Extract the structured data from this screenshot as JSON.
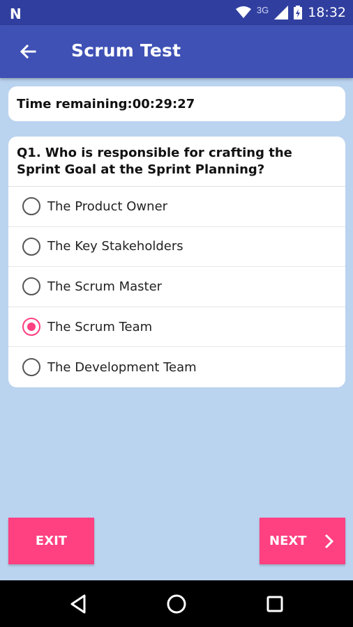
{
  "status_bar": {
    "notification_icon": "N",
    "network_label": "3G",
    "time": "18:32",
    "icons": [
      "wifi-icon",
      "signal-icon",
      "battery-icon"
    ]
  },
  "app_bar": {
    "back_icon": "arrow-back-icon",
    "title": "Scrum Test"
  },
  "timer": {
    "text": "Time remaining:00:29:27"
  },
  "question": {
    "text": "Q1. Who is responsible for crafting the Sprint Goal at the Sprint Planning?",
    "options": [
      {
        "label": "The Product Owner",
        "selected": false
      },
      {
        "label": "The Key Stakeholders",
        "selected": false
      },
      {
        "label": "The Scrum Master",
        "selected": false
      },
      {
        "label": "The Scrum Team",
        "selected": true
      },
      {
        "label": "The Development Team",
        "selected": false
      }
    ]
  },
  "buttons": {
    "exit_label": "EXIT",
    "next_label": "NEXT",
    "next_icon": "chevron-right-icon"
  },
  "nav_bar": {
    "icons": [
      "back-triangle-icon",
      "home-circle-icon",
      "recents-square-icon"
    ]
  },
  "colors": {
    "status_bar": "#303f9f",
    "app_bar": "#3f51b5",
    "background": "#bad3ef",
    "accent": "#ff4081"
  }
}
